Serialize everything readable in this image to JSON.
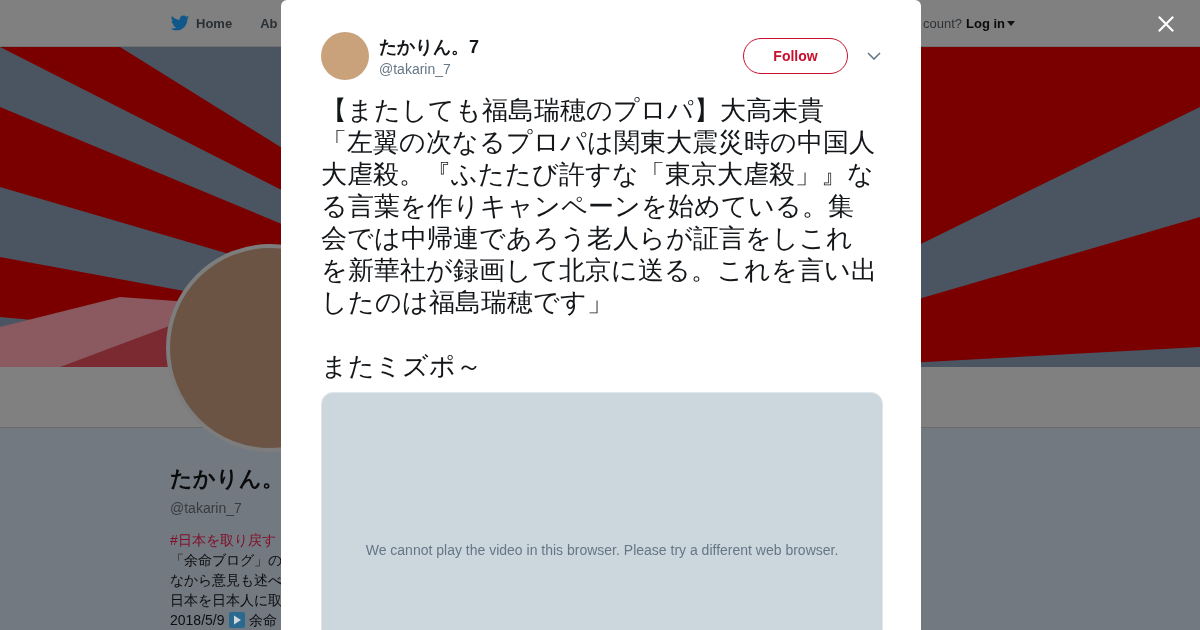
{
  "nav": {
    "items": [
      {
        "label": "Home",
        "kind": "home"
      },
      {
        "label": "Ab",
        "kind": "plain"
      }
    ],
    "account_prompt": "count?",
    "login": "Log in"
  },
  "profile": {
    "name": "たかりん。",
    "handle": "@takarin_7",
    "bio": [
      {
        "kind": "hashtag",
        "text": "#日本を取り戻す"
      },
      {
        "kind": "text",
        "text": "「余命ブログ」の"
      },
      {
        "kind": "text",
        "text": "なから意見も述べ"
      },
      {
        "kind": "text",
        "text": "日本を日本人に取"
      },
      {
        "kind": "dated",
        "text": "2018/5/9",
        "after": "余命"
      }
    ]
  },
  "tweet": {
    "name": "たかりん。7",
    "handle": "@takarin_7",
    "follow": "Follow",
    "text": "【またしても福島瑞穂のプロパ】大高未貴",
    "text_3": "「左翼の次なるプロパは関東大震災時の中国人大虐殺。『ふたたび許すな「東京大虐殺」』なる言葉を作りキャンペーンを始めている。集会では中帰連であろう老人らが証言をしこれを新華社が録画して北京に送る。これを言い出したのは福島瑞穂です」",
    "text_2": "またミズポ～",
    "video_message": "We cannot play the video in this browser. Please try a different web browser."
  }
}
